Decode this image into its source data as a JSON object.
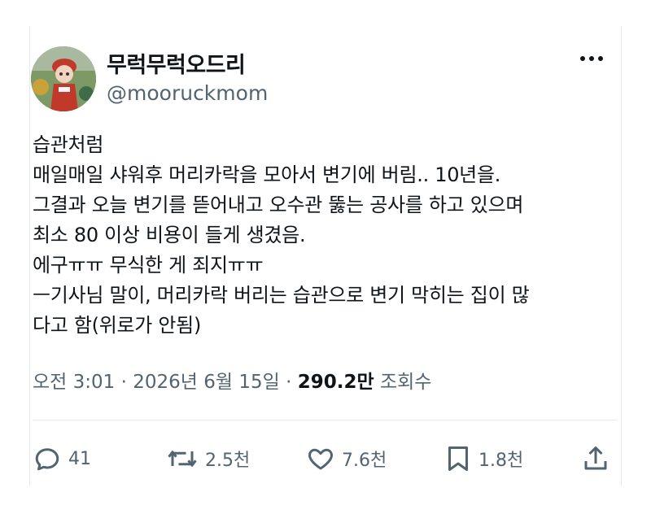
{
  "user": {
    "display_name": "무럭무럭오드리",
    "handle": "@mooruckmom",
    "avatar_icon": "avatar-photo-doll"
  },
  "tweet": {
    "lines": [
      "습관처럼",
      "매일매일 샤워후 머리카락을 모아서 변기에 버림.. 10년을.",
      "그결과 오늘 변기를 뜯어내고 오수관 뚫는 공사를 하고 있으며",
      "최소 80 이상 비용이 들게 생겼음.",
      "에구ㅠㅠ 무식한 게 죄지ㅠㅠ",
      "ㅡ기사님 말이, 머리카락 버리는 습관으로 변기 막히는 집이 많",
      "다고 함(위로가 안됨)"
    ]
  },
  "meta": {
    "time": "오전 3:01",
    "separator": "·",
    "date": "2026년 6월 15일",
    "views_count": "290.2만",
    "views_label": "조회수"
  },
  "actions": {
    "reply": {
      "icon": "reply-icon",
      "count": "41"
    },
    "retweet": {
      "icon": "retweet-icon",
      "count": "2.5천"
    },
    "like": {
      "icon": "heart-icon",
      "count": "7.6천"
    },
    "bookmark": {
      "icon": "bookmark-icon",
      "count": "1.8천"
    },
    "share": {
      "icon": "share-icon"
    }
  },
  "colors": {
    "text": "#0f1419",
    "secondary": "#536471",
    "divider": "#e6e9ec"
  }
}
